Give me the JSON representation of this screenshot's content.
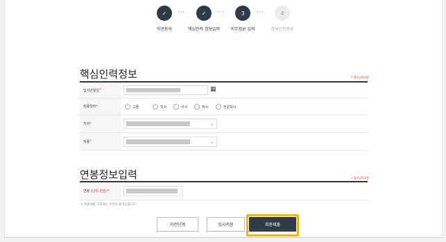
{
  "stepper": {
    "steps": [
      {
        "label": "약관동의",
        "symbol": "✓",
        "state": "done"
      },
      {
        "label": "핵심인력 정보입력",
        "symbol": "✓",
        "state": "done"
      },
      {
        "label": "직무정보 입력",
        "symbol": "3",
        "state": "active"
      },
      {
        "label": "참여신청완료",
        "symbol": "4",
        "state": "todo"
      }
    ],
    "separator": "···"
  },
  "section1": {
    "title": "핵심인력정보",
    "required_note": "• 필수입력사항",
    "rows": {
      "join_date": {
        "label": "입사년월일",
        "req": "*"
      },
      "education": {
        "label": "최종학력",
        "req": "*",
        "options": [
          "고졸",
          "학사",
          "석사",
          "박사",
          "전문학사"
        ]
      },
      "position": {
        "label": "직위",
        "req": "*"
      },
      "duty": {
        "label": "직종",
        "req": "*"
      }
    }
  },
  "section2": {
    "title": "연봉정보입력",
    "required_note": "• 필수입력사항",
    "salary": {
      "label": "연봉",
      "unit": "(단위:만원)",
      "req": "*"
    }
  },
  "notice": "※ 최종제출 이후에는 수정이 불가능합니다.",
  "buttons": {
    "prev": "이전단계",
    "save": "임시저장",
    "submit": "최종제출"
  }
}
